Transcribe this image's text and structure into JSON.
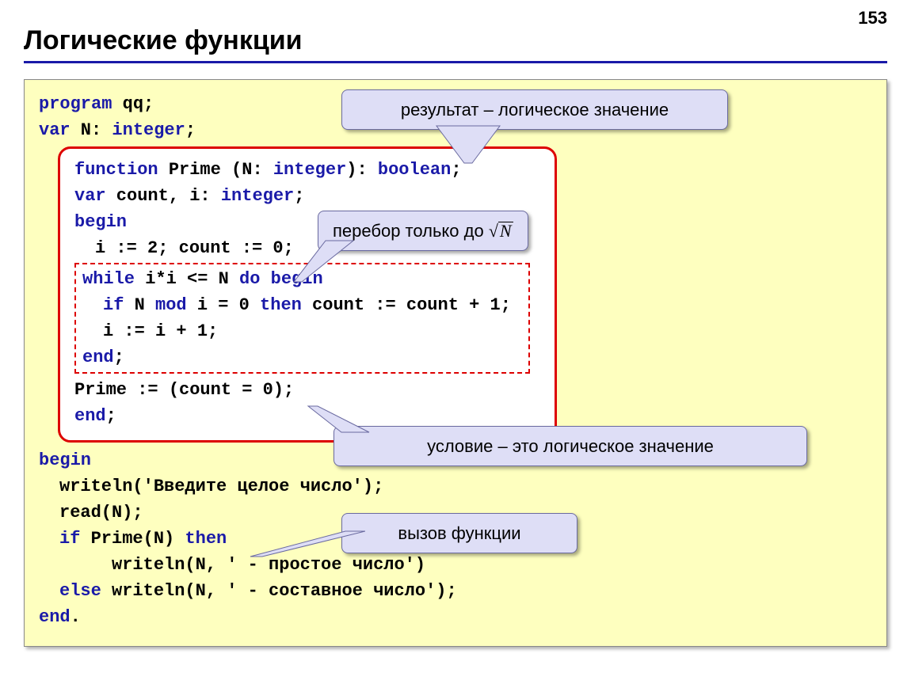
{
  "page_number": "153",
  "title": "Логические функции",
  "code": {
    "l1a": "program",
    "l1b": " qq;",
    "l2a": "var",
    "l2b": " N: ",
    "l2c": "integer",
    "l2d": ";",
    "f1a": "function",
    "f1b": " Prime (N: ",
    "f1c": "integer",
    "f1d": "): ",
    "f1e": "boolean",
    "f1f": ";",
    "f2a": "var",
    "f2b": " count, i: ",
    "f2c": "integer",
    "f2d": ";",
    "f3": "begin",
    "f4": "i := 2; count := 0;",
    "d1a": "while",
    "d1b": " i*i <= N ",
    "d1c": "do begin",
    "d2a": "if",
    "d2b": " N ",
    "d2c": "mod",
    "d2d": " i = 0 ",
    "d2e": "then",
    "d2f": " count := count + 1;",
    "d3": "i := i + 1;",
    "d4": "end",
    "d4b": ";",
    "f5": "Prime := (count = 0);",
    "f6": "end",
    "f6b": ";",
    "m1": "begin",
    "m2": "writeln('Введите целое число');",
    "m3": "read(N);",
    "m4a": "if",
    "m4b": " Prime(N) ",
    "m4c": "then",
    "m5": "writeln(N, ' - простое число')",
    "m6a": "else",
    "m6b": " writeln(N, ' - составное число');",
    "m7": "end",
    "m7b": "."
  },
  "callouts": {
    "c1": "результат – логическое значение",
    "c2_prefix": "перебор только до ",
    "c2_sqrt": "N",
    "c3": "условие – это логическое значение",
    "c4": "вызов функции"
  }
}
